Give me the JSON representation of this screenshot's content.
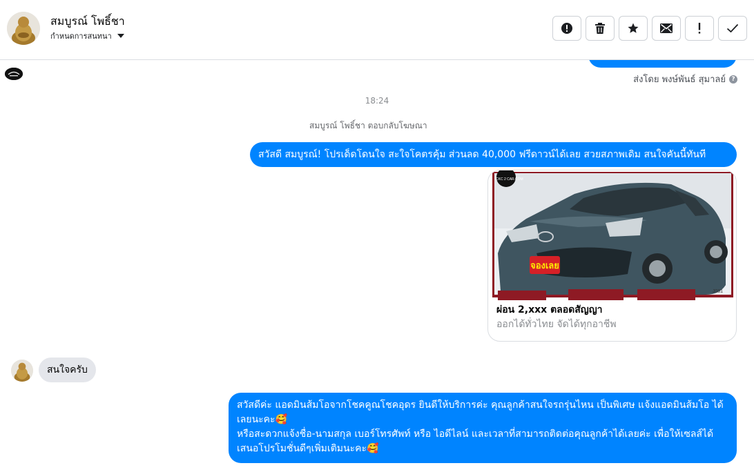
{
  "header": {
    "contact_name": "สมบูรณ์ โพธิ์ชา",
    "assign_label": "กำหนดการสนทนา",
    "actions": [
      {
        "name": "mark-spam-button",
        "icon": "alert-circle-icon"
      },
      {
        "name": "delete-button",
        "icon": "trash-icon"
      },
      {
        "name": "star-button",
        "icon": "star-icon"
      },
      {
        "name": "mark-unread-button",
        "icon": "envelope-icon"
      },
      {
        "name": "follow-up-button",
        "icon": "exclamation-icon"
      },
      {
        "name": "mark-done-button",
        "icon": "check-icon"
      }
    ]
  },
  "thread": {
    "sent_by": "ส่งโดย พงษ์พันธ์ สุมาลย์",
    "timestamp": "18:24",
    "system_note": "สมบูรณ์ โพธิ์ชา ตอบกลับโฆษณา",
    "messages": [
      {
        "from": "page",
        "text": "สวัสดี สมบูรณ์! โปรเด็ดโดนใจ สะใจโคตรคุ้ม ส่วนลด 40,000 ฟรีดาวน์ได้เลย สวยสภาพเดิม สนใจคันนี้ทันที"
      },
      {
        "from": "page",
        "type": "ad_card",
        "image_badge": "จองเลย",
        "image_watermark": "CKC 2 CAR.COM",
        "image_code": "J081",
        "title": "ผ่อน 2,xxx ตลอดสัญญา",
        "subtitle": "ออกได้ทั่วไทย จัดได้ทุกอาชีพ"
      },
      {
        "from": "customer",
        "text": "สนใจครับ"
      },
      {
        "from": "page",
        "lines": [
          "สวัสดีค่ะ แอดมินส้มโอจากโชคคูณโชคอุดร ยินดีให้บริการค่ะ คุณลูกค้าสนใจรถรุ่นไหน เป็นพิเศษ แจ้งแอดมินส้มโอ ได้เลยนะคะ🥰",
          "หรือสะดวกแจ้งชื่อ-นามสกุล เบอร์โทรศัพท์ หรือ ไอดีไลน์ และเวลาที่สามารถติดต่อคุณลูกค้าได้เลยค่ะ เพื่อให้เซลส์ได้เสนอโปรโมชั่นดีๆเพิ่มเติมนะคะ🥰"
        ]
      }
    ]
  },
  "colors": {
    "accent": "#0084ff",
    "incoming_bubble": "#e4e6eb"
  }
}
